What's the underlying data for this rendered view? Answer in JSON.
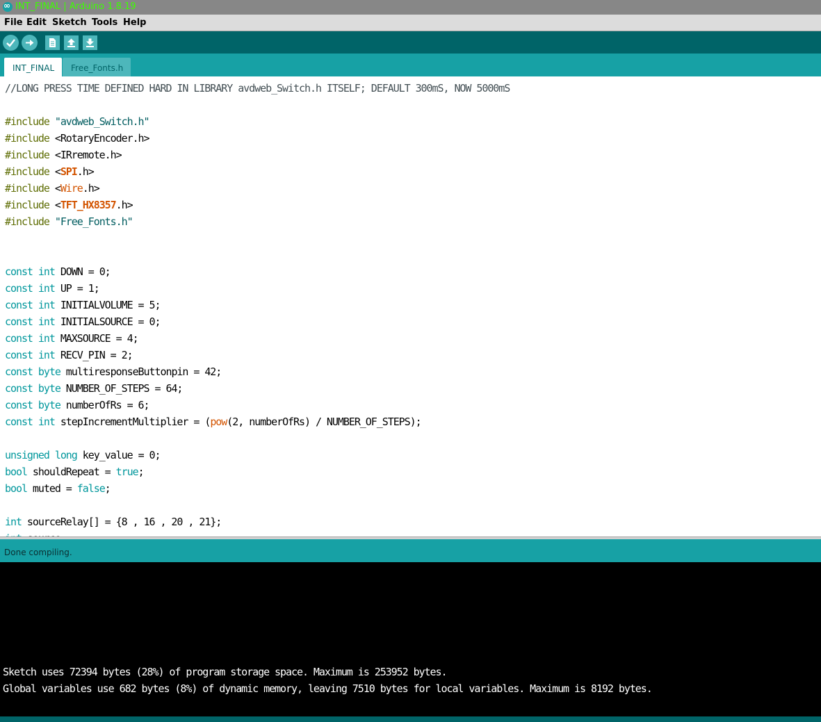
{
  "window": {
    "title": "INT_FINAL | Arduino 1.8.19"
  },
  "menu": [
    "File",
    "Edit",
    "Sketch",
    "Tools",
    "Help"
  ],
  "toolbar": {
    "icons": [
      "verify-checkmark-icon",
      "upload-arrow-icon",
      "new-sketch-icon",
      "open-sketch-icon",
      "save-sketch-icon"
    ]
  },
  "tabs": [
    {
      "label": "INT_FINAL",
      "active": true
    },
    {
      "label": "Free_Fonts.h",
      "active": false
    }
  ],
  "editor": {
    "lines": [
      [
        [
          "//LONG PRESS TIME DEFINED HARD IN LIBRARY avdweb_Switch.h ITSELF; DEFAULT 300mS, NOW 5000mS",
          "cm"
        ]
      ],
      [],
      [
        [
          "#include",
          "pp"
        ],
        [
          " "
        ],
        [
          "\"avdweb_Switch.h\"",
          "str"
        ]
      ],
      [
        [
          "#include",
          "pp"
        ],
        [
          " <RotaryEncoder.h>"
        ]
      ],
      [
        [
          "#include",
          "pp"
        ],
        [
          " <IRremote.h>"
        ]
      ],
      [
        [
          "#include",
          "pp"
        ],
        [
          " <"
        ],
        [
          "SPI",
          "lib"
        ],
        [
          ".h>"
        ]
      ],
      [
        [
          "#include",
          "pp"
        ],
        [
          " <"
        ],
        [
          "Wire",
          "fn"
        ],
        [
          ".h>"
        ]
      ],
      [
        [
          "#include",
          "pp"
        ],
        [
          " <"
        ],
        [
          "TFT_HX8357",
          "lib"
        ],
        [
          ".h>"
        ]
      ],
      [
        [
          "#include",
          "pp"
        ],
        [
          " "
        ],
        [
          "\"Free_Fonts.h\"",
          "str"
        ]
      ],
      [],
      [],
      [
        [
          "const",
          "kw"
        ],
        [
          " "
        ],
        [
          "int",
          "kw"
        ],
        [
          " DOWN = 0;"
        ]
      ],
      [
        [
          "const",
          "kw"
        ],
        [
          " "
        ],
        [
          "int",
          "kw"
        ],
        [
          " UP = 1;"
        ]
      ],
      [
        [
          "const",
          "kw"
        ],
        [
          " "
        ],
        [
          "int",
          "kw"
        ],
        [
          " INITIALVOLUME = 5;"
        ]
      ],
      [
        [
          "const",
          "kw"
        ],
        [
          " "
        ],
        [
          "int",
          "kw"
        ],
        [
          " INITIALSOURCE = 0;"
        ]
      ],
      [
        [
          "const",
          "kw"
        ],
        [
          " "
        ],
        [
          "int",
          "kw"
        ],
        [
          " MAXSOURCE = 4;"
        ]
      ],
      [
        [
          "const",
          "kw"
        ],
        [
          " "
        ],
        [
          "int",
          "kw"
        ],
        [
          " RECV_PIN = 2;"
        ]
      ],
      [
        [
          "const",
          "kw"
        ],
        [
          " "
        ],
        [
          "byte",
          "kw"
        ],
        [
          " multiresponseButtonpin = 42;"
        ]
      ],
      [
        [
          "const",
          "kw"
        ],
        [
          " "
        ],
        [
          "byte",
          "kw"
        ],
        [
          " NUMBER_OF_STEPS = 64;"
        ]
      ],
      [
        [
          "const",
          "kw"
        ],
        [
          " "
        ],
        [
          "byte",
          "kw"
        ],
        [
          " numberOfRs = 6;"
        ]
      ],
      [
        [
          "const",
          "kw"
        ],
        [
          " "
        ],
        [
          "int",
          "kw"
        ],
        [
          " stepIncrementMultiplier = ("
        ],
        [
          "pow",
          "fn"
        ],
        [
          "(2, numberOfRs) / NUMBER_OF_STEPS);"
        ]
      ],
      [],
      [
        [
          "unsigned",
          "kw"
        ],
        [
          " "
        ],
        [
          "long",
          "kw"
        ],
        [
          " key_value = 0;"
        ]
      ],
      [
        [
          "bool",
          "kw"
        ],
        [
          " shouldRepeat = "
        ],
        [
          "true",
          "kw"
        ],
        [
          ";"
        ]
      ],
      [
        [
          "bool",
          "kw"
        ],
        [
          " muted = "
        ],
        [
          "false",
          "kw"
        ],
        [
          ";"
        ]
      ],
      [],
      [
        [
          "int",
          "kw"
        ],
        [
          " sourceRelay[] = {8 , 16 , 20 , 21};"
        ]
      ],
      [
        [
          "int",
          "kw"
        ],
        [
          " source;"
        ]
      ]
    ]
  },
  "status": {
    "message": "Done compiling."
  },
  "console": {
    "lines": [
      "Sketch uses 72394 bytes (28%) of program storage space. Maximum is 253952 bytes.",
      "Global variables use 682 bytes (8%) of dynamic memory, leaving 7510 bytes for local variables. Maximum is 8192 bytes."
    ]
  },
  "colors": {
    "toolbar_bg": "#006468",
    "tab_strip_bg": "#17a1a5",
    "keyword": "#00979c",
    "preprocessor": "#5e6d03",
    "library": "#d35400",
    "title_text": "#3cff00"
  }
}
